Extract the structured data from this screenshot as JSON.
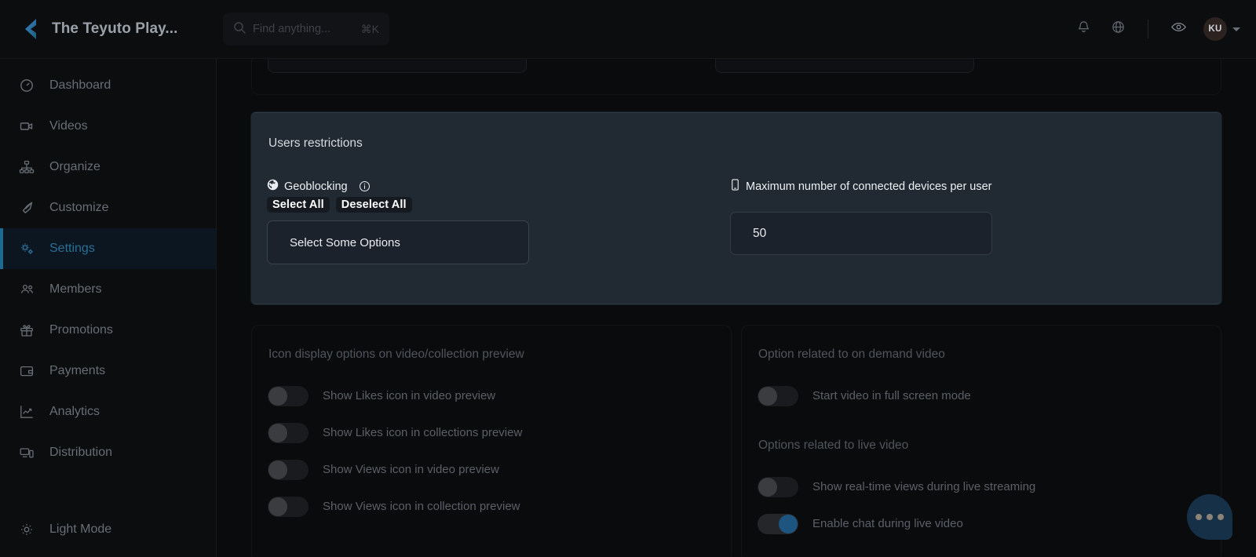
{
  "header": {
    "brand_title": "The Teyuto Play...",
    "logo_icon": "teyuto-logo-icon",
    "search": {
      "icon": "search-icon",
      "placeholder": "Find anything...",
      "shortcut": "⌘K"
    },
    "actions": [
      {
        "icon": "bell-icon",
        "name": "notifications-button"
      },
      {
        "icon": "globe-icon",
        "name": "language-button"
      },
      {
        "icon": "eye-icon",
        "name": "preview-button"
      }
    ],
    "avatar_initials": "KU",
    "avatar_caret": "chevron-down-icon"
  },
  "sidebar": {
    "items": [
      {
        "label": "Dashboard",
        "icon": "gauge-icon",
        "active": false
      },
      {
        "label": "Videos",
        "icon": "video-camera-icon",
        "active": false
      },
      {
        "label": "Organize",
        "icon": "sitemap-icon",
        "active": false
      },
      {
        "label": "Customize",
        "icon": "brush-icon",
        "active": false
      },
      {
        "label": "Settings",
        "icon": "gears-icon",
        "active": true
      },
      {
        "label": "Members",
        "icon": "users-icon",
        "active": false
      },
      {
        "label": "Promotions",
        "icon": "gift-icon",
        "active": false
      },
      {
        "label": "Payments",
        "icon": "wallet-icon",
        "active": false
      },
      {
        "label": "Analytics",
        "icon": "chart-line-icon",
        "active": false
      },
      {
        "label": "Distribution",
        "icon": "devices-icon",
        "active": false
      }
    ],
    "footer": {
      "label": "Light Mode",
      "icon": "sun-gear-icon"
    }
  },
  "main": {
    "panel": {
      "title": "Users restrictions",
      "geoblocking": {
        "label": "Geoblocking",
        "icon": "globe-icon",
        "info_icon": "info-circle-icon",
        "select_all_label": "Select All",
        "deselect_all_label": "Deselect All",
        "select_placeholder": "Select Some Options"
      },
      "max_devices": {
        "label": "Maximum number of connected devices per user",
        "icon": "mobile-icon",
        "value": "50"
      }
    },
    "left_card": {
      "title": "Icon display options on video/collection preview",
      "options": [
        {
          "label": "Show Likes icon in video preview",
          "on": false
        },
        {
          "label": "Show Likes icon in collections preview",
          "on": false
        },
        {
          "label": "Show Views icon in video preview",
          "on": false
        },
        {
          "label": "Show Views icon in collection preview",
          "on": false
        }
      ]
    },
    "right_card": {
      "title_vod": "Option related to on demand video",
      "options_vod": [
        {
          "label": "Start video in full screen mode",
          "on": false
        }
      ],
      "title_live": "Options related to live video",
      "options_live": [
        {
          "label": "Show real-time views during live streaming",
          "on": false
        },
        {
          "label": "Enable chat during live video",
          "on": true
        }
      ]
    }
  },
  "chat_widget": {
    "icon": "chat-bubble-dots-icon"
  },
  "colors": {
    "page_bg": "#0a0b0d",
    "panel_bg": "#212932",
    "accent": "#1d6a93",
    "toggle_on": "#1d5480",
    "chat_fab_bg": "#163047"
  }
}
